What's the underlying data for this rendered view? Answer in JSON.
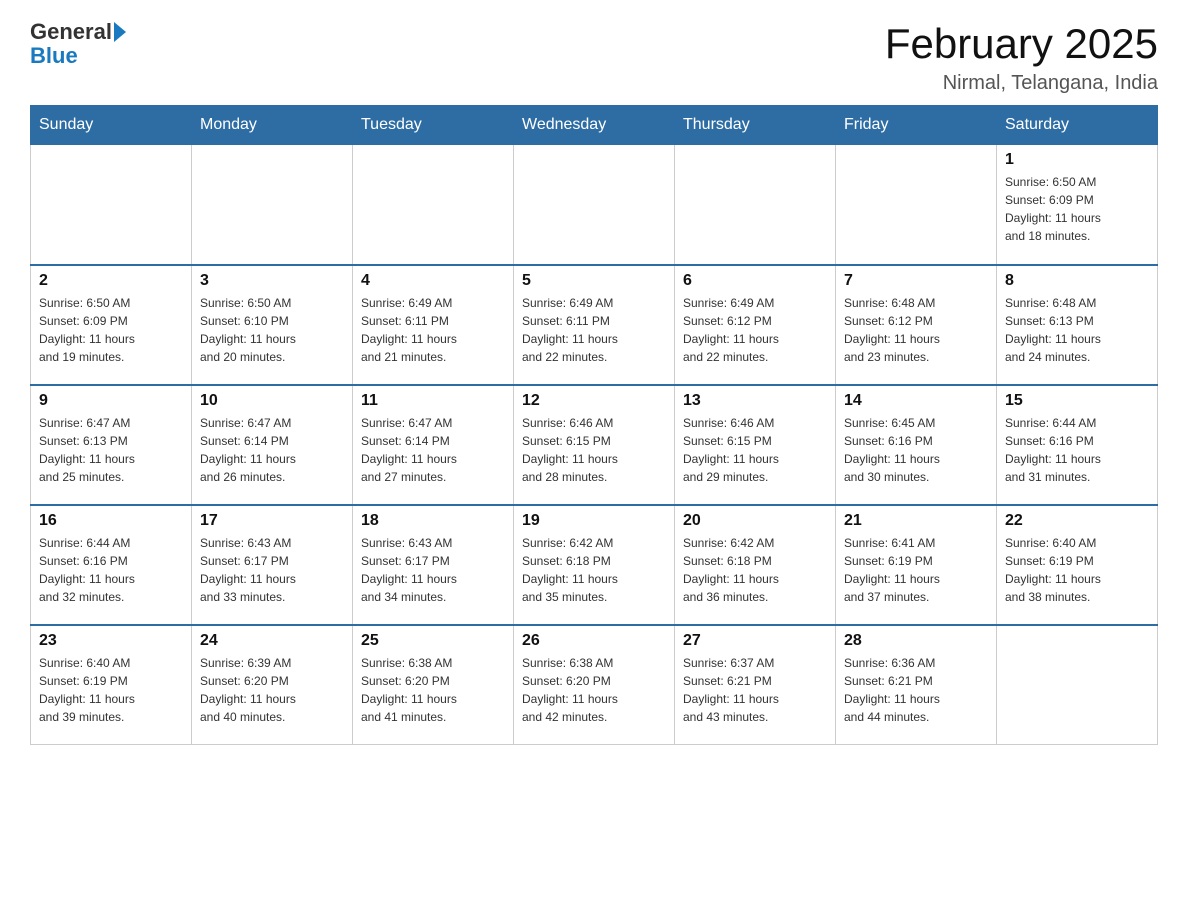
{
  "logo": {
    "text_general": "General",
    "text_blue": "Blue"
  },
  "title": "February 2025",
  "location": "Nirmal, Telangana, India",
  "days_of_week": [
    "Sunday",
    "Monday",
    "Tuesday",
    "Wednesday",
    "Thursday",
    "Friday",
    "Saturday"
  ],
  "weeks": [
    [
      {
        "day": "",
        "info": ""
      },
      {
        "day": "",
        "info": ""
      },
      {
        "day": "",
        "info": ""
      },
      {
        "day": "",
        "info": ""
      },
      {
        "day": "",
        "info": ""
      },
      {
        "day": "",
        "info": ""
      },
      {
        "day": "1",
        "info": "Sunrise: 6:50 AM\nSunset: 6:09 PM\nDaylight: 11 hours\nand 18 minutes."
      }
    ],
    [
      {
        "day": "2",
        "info": "Sunrise: 6:50 AM\nSunset: 6:09 PM\nDaylight: 11 hours\nand 19 minutes."
      },
      {
        "day": "3",
        "info": "Sunrise: 6:50 AM\nSunset: 6:10 PM\nDaylight: 11 hours\nand 20 minutes."
      },
      {
        "day": "4",
        "info": "Sunrise: 6:49 AM\nSunset: 6:11 PM\nDaylight: 11 hours\nand 21 minutes."
      },
      {
        "day": "5",
        "info": "Sunrise: 6:49 AM\nSunset: 6:11 PM\nDaylight: 11 hours\nand 22 minutes."
      },
      {
        "day": "6",
        "info": "Sunrise: 6:49 AM\nSunset: 6:12 PM\nDaylight: 11 hours\nand 22 minutes."
      },
      {
        "day": "7",
        "info": "Sunrise: 6:48 AM\nSunset: 6:12 PM\nDaylight: 11 hours\nand 23 minutes."
      },
      {
        "day": "8",
        "info": "Sunrise: 6:48 AM\nSunset: 6:13 PM\nDaylight: 11 hours\nand 24 minutes."
      }
    ],
    [
      {
        "day": "9",
        "info": "Sunrise: 6:47 AM\nSunset: 6:13 PM\nDaylight: 11 hours\nand 25 minutes."
      },
      {
        "day": "10",
        "info": "Sunrise: 6:47 AM\nSunset: 6:14 PM\nDaylight: 11 hours\nand 26 minutes."
      },
      {
        "day": "11",
        "info": "Sunrise: 6:47 AM\nSunset: 6:14 PM\nDaylight: 11 hours\nand 27 minutes."
      },
      {
        "day": "12",
        "info": "Sunrise: 6:46 AM\nSunset: 6:15 PM\nDaylight: 11 hours\nand 28 minutes."
      },
      {
        "day": "13",
        "info": "Sunrise: 6:46 AM\nSunset: 6:15 PM\nDaylight: 11 hours\nand 29 minutes."
      },
      {
        "day": "14",
        "info": "Sunrise: 6:45 AM\nSunset: 6:16 PM\nDaylight: 11 hours\nand 30 minutes."
      },
      {
        "day": "15",
        "info": "Sunrise: 6:44 AM\nSunset: 6:16 PM\nDaylight: 11 hours\nand 31 minutes."
      }
    ],
    [
      {
        "day": "16",
        "info": "Sunrise: 6:44 AM\nSunset: 6:16 PM\nDaylight: 11 hours\nand 32 minutes."
      },
      {
        "day": "17",
        "info": "Sunrise: 6:43 AM\nSunset: 6:17 PM\nDaylight: 11 hours\nand 33 minutes."
      },
      {
        "day": "18",
        "info": "Sunrise: 6:43 AM\nSunset: 6:17 PM\nDaylight: 11 hours\nand 34 minutes."
      },
      {
        "day": "19",
        "info": "Sunrise: 6:42 AM\nSunset: 6:18 PM\nDaylight: 11 hours\nand 35 minutes."
      },
      {
        "day": "20",
        "info": "Sunrise: 6:42 AM\nSunset: 6:18 PM\nDaylight: 11 hours\nand 36 minutes."
      },
      {
        "day": "21",
        "info": "Sunrise: 6:41 AM\nSunset: 6:19 PM\nDaylight: 11 hours\nand 37 minutes."
      },
      {
        "day": "22",
        "info": "Sunrise: 6:40 AM\nSunset: 6:19 PM\nDaylight: 11 hours\nand 38 minutes."
      }
    ],
    [
      {
        "day": "23",
        "info": "Sunrise: 6:40 AM\nSunset: 6:19 PM\nDaylight: 11 hours\nand 39 minutes."
      },
      {
        "day": "24",
        "info": "Sunrise: 6:39 AM\nSunset: 6:20 PM\nDaylight: 11 hours\nand 40 minutes."
      },
      {
        "day": "25",
        "info": "Sunrise: 6:38 AM\nSunset: 6:20 PM\nDaylight: 11 hours\nand 41 minutes."
      },
      {
        "day": "26",
        "info": "Sunrise: 6:38 AM\nSunset: 6:20 PM\nDaylight: 11 hours\nand 42 minutes."
      },
      {
        "day": "27",
        "info": "Sunrise: 6:37 AM\nSunset: 6:21 PM\nDaylight: 11 hours\nand 43 minutes."
      },
      {
        "day": "28",
        "info": "Sunrise: 6:36 AM\nSunset: 6:21 PM\nDaylight: 11 hours\nand 44 minutes."
      },
      {
        "day": "",
        "info": ""
      }
    ]
  ]
}
